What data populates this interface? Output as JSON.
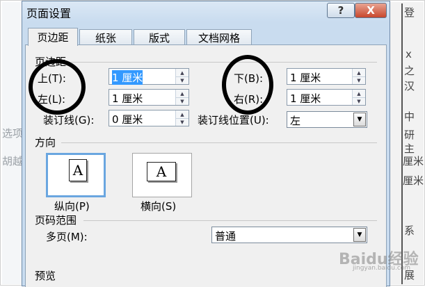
{
  "background": {
    "left_fragments": [
      "选项",
      "胡越"
    ],
    "right_fragments": [
      "登",
      "x",
      "之",
      "汉",
      "中",
      "研",
      "主",
      "厘米",
      "厘米",
      "系",
      "展"
    ]
  },
  "dialog": {
    "title": "页面设置",
    "help_label": "?",
    "close_label": "X",
    "tabs": [
      "页边距",
      "纸张",
      "版式",
      "文档网格"
    ],
    "active_tab": "页边距",
    "margins_group": "页边距",
    "top_label": "上(T):",
    "top_value": "1 厘米",
    "bottom_label": "下(B):",
    "bottom_value": "1 厘米",
    "left_label": "左(L):",
    "left_value": "1 厘米",
    "right_label": "右(R):",
    "right_value": "1 厘米",
    "gutter_label": "装订线(G):",
    "gutter_value": "0 厘米",
    "gutter_pos_label": "装订线位置(U):",
    "gutter_pos_value": "左",
    "orientation_group": "方向",
    "portrait_glyph": "A",
    "portrait_label": "纵向(P)",
    "landscape_glyph": "A",
    "landscape_label": "横向(S)",
    "pages_group": "页码范围",
    "multiple_pages_label": "多页(M):",
    "multiple_pages_value": "普通",
    "preview_group": "预览"
  },
  "watermark": {
    "main": "Baidu经验",
    "sub": "jingyan.baidu.com"
  },
  "colors": {
    "selection": "#3399ff",
    "close_button": "#c8472c",
    "title_bar": "#c9dcef",
    "annotation": "#000000"
  }
}
